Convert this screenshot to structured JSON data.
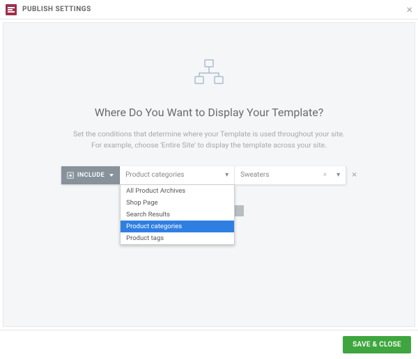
{
  "header": {
    "title": "PUBLISH SETTINGS"
  },
  "main": {
    "title": "Where Do You Want to Display Your Template?",
    "description_line1": "Set the conditions that determine where your Template is used throughout your site.",
    "description_line2": "For example, choose 'Entire Site' to display the template across your site."
  },
  "condition": {
    "include_label": "INCLUDE",
    "scope_selected": "Product categories",
    "value_selected": "Sweaters",
    "dropdown_items": [
      "All Product Archives",
      "Shop Page",
      "Search Results",
      "Product categories",
      "Product tags"
    ],
    "dropdown_selected_index": 3
  },
  "footer": {
    "save_label": "SAVE & CLOSE"
  }
}
